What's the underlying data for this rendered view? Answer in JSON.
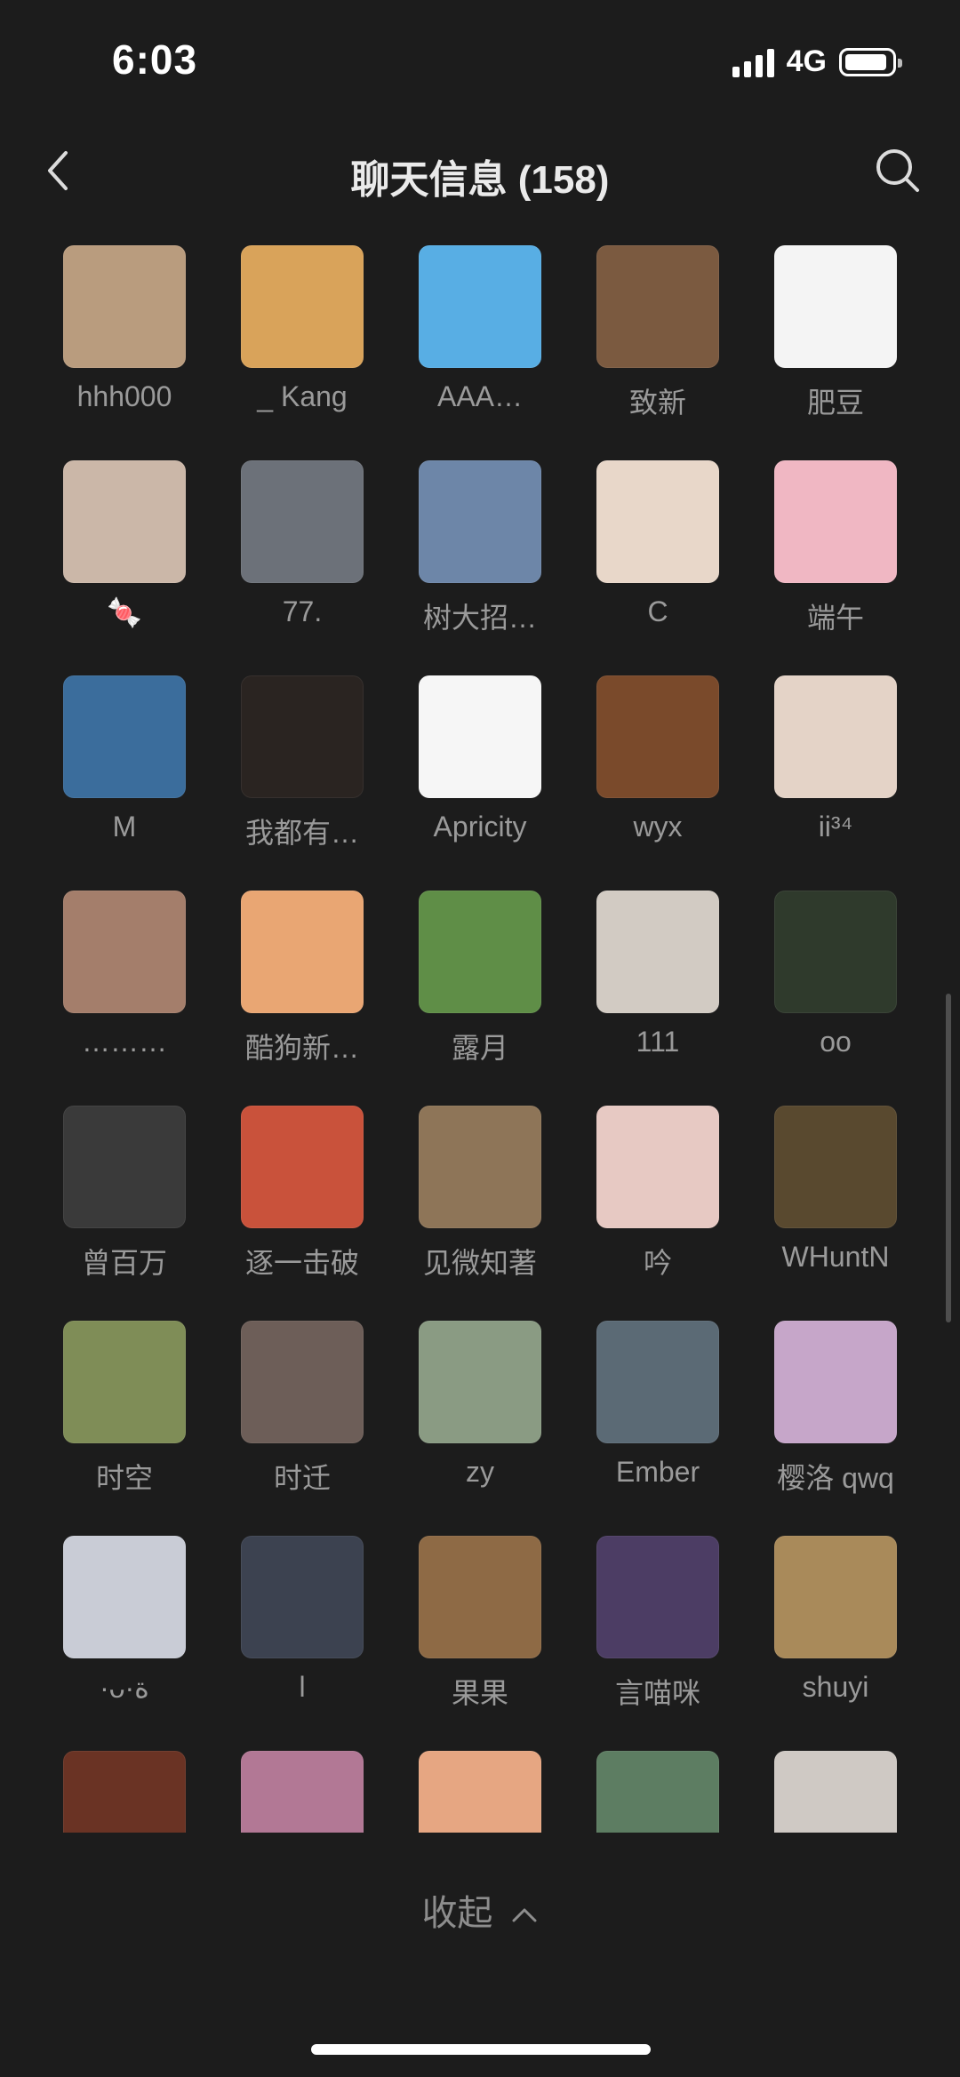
{
  "status_bar": {
    "time": "6:03",
    "network": "4G",
    "battery_level": 0.85
  },
  "header": {
    "title": "聊天信息 (158)",
    "back_icon": "chevron-left-icon",
    "search_icon": "search-icon"
  },
  "members": [
    {
      "name": "hhh000",
      "avatar_color": "#b99c7e"
    },
    {
      "name": "_ Kang",
      "avatar_color": "#d9a35a"
    },
    {
      "name": "AAA…",
      "avatar_color": "#58aee4"
    },
    {
      "name": "致新",
      "avatar_color": "#7b5a40"
    },
    {
      "name": "肥豆",
      "avatar_color": "#f4f4f4"
    },
    {
      "name": "🍬",
      "avatar_color": "#cbb7a8"
    },
    {
      "name": "77.",
      "avatar_color": "#6c7179"
    },
    {
      "name": "树大招…",
      "avatar_color": "#6d86a8"
    },
    {
      "name": "C",
      "avatar_color": "#e8d7c9"
    },
    {
      "name": "端午",
      "avatar_color": "#f0b7c3"
    },
    {
      "name": "M",
      "avatar_color": "#3b6d9c"
    },
    {
      "name": "我都有…",
      "avatar_color": "#2a2421"
    },
    {
      "name": "Apricity",
      "avatar_color": "#f6f6f6"
    },
    {
      "name": "wyx",
      "avatar_color": "#7a4a2b"
    },
    {
      "name": "ii³⁴",
      "avatar_color": "#e4d3c7"
    },
    {
      "name": "………",
      "avatar_color": "#a47e6b"
    },
    {
      "name": "酷狗新…",
      "avatar_color": "#e9a673"
    },
    {
      "name": "露月",
      "avatar_color": "#5f8e47"
    },
    {
      "name": "111",
      "avatar_color": "#d2cbc3"
    },
    {
      "name": "oo",
      "avatar_color": "#2f3a2c"
    },
    {
      "name": "曾百万",
      "avatar_color": "#3a3a3a"
    },
    {
      "name": "逐一击破",
      "avatar_color": "#c9523b"
    },
    {
      "name": "见微知著",
      "avatar_color": "#8e7558"
    },
    {
      "name": "吟",
      "avatar_color": "#e7c9c3"
    },
    {
      "name": "WHuntN",
      "avatar_color": "#59492f"
    },
    {
      "name": "时空",
      "avatar_color": "#7f8d57"
    },
    {
      "name": "时迁",
      "avatar_color": "#6d5e58"
    },
    {
      "name": "zy",
      "avatar_color": "#8a9b83"
    },
    {
      "name": "Ember",
      "avatar_color": "#5b6a75"
    },
    {
      "name": "樱洛 qwq",
      "avatar_color": "#c6a6c9"
    },
    {
      "name": "·ᴗ·ة",
      "avatar_color": "#c9ccd6"
    },
    {
      "name": "l",
      "avatar_color": "#3c4250"
    },
    {
      "name": "果果",
      "avatar_color": "#8e6a45"
    },
    {
      "name": "言喵咪",
      "avatar_color": "#4c3d64"
    },
    {
      "name": "shuyi",
      "avatar_color": "#a98a5a"
    },
    {
      "name": "",
      "avatar_color": "#6a3324"
    },
    {
      "name": "",
      "avatar_color": "#b27895"
    },
    {
      "name": "",
      "avatar_color": "#e6a682"
    },
    {
      "name": "",
      "avatar_color": "#5d7d62"
    },
    {
      "name": "",
      "avatar_color": "#cfc9c4"
    }
  ],
  "footer": {
    "collapse_label": "收起",
    "collapse_icon": "chevron-up-icon"
  }
}
